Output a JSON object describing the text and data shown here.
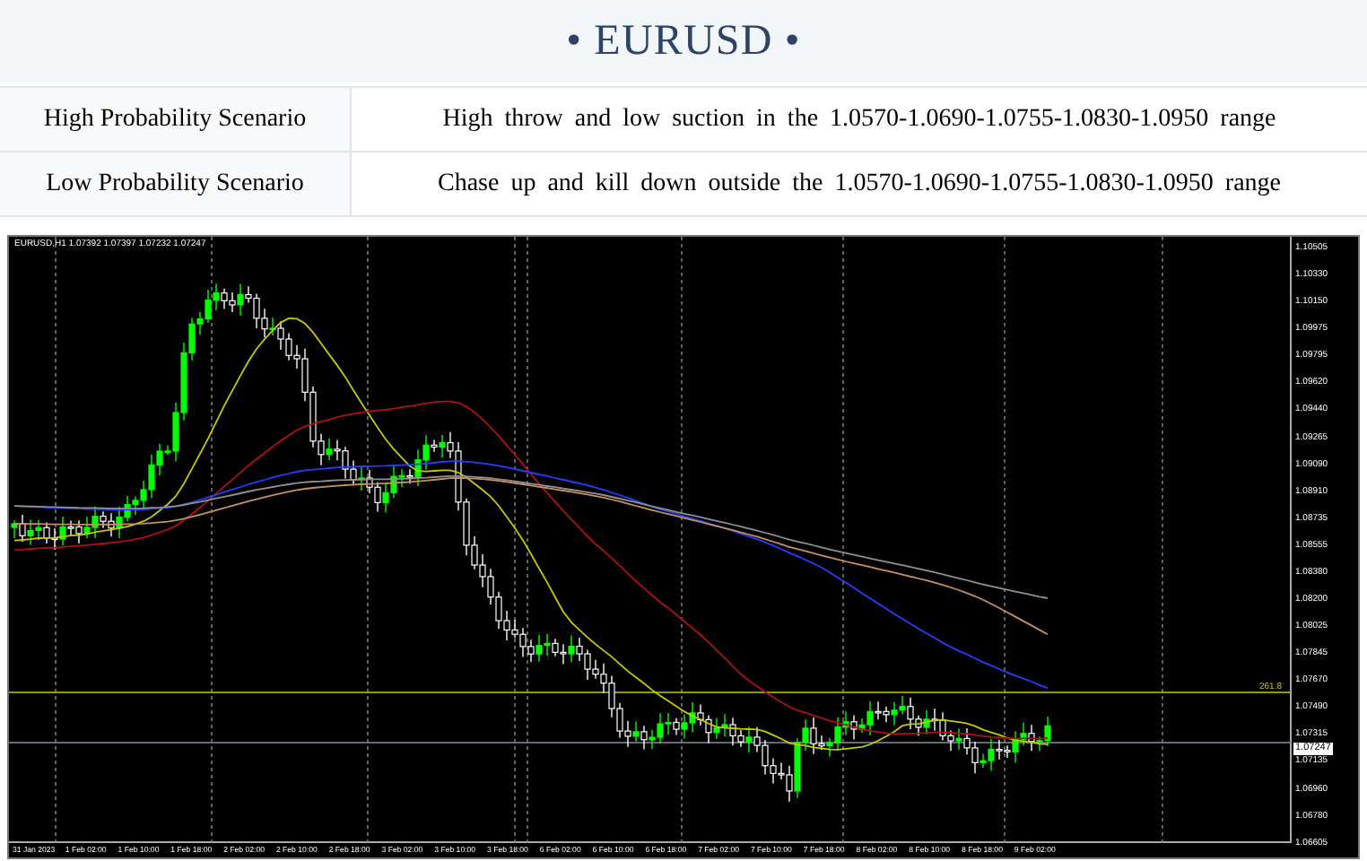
{
  "title": "• EURUSD •",
  "scenarios": [
    {
      "label": "High Probability Scenario",
      "description": "High throw and low suction in the 1.0570-1.0690-1.0755-1.0830-1.0950 range"
    },
    {
      "label": "Low Probability Scenario",
      "description": "Chase up and kill down outside the 1.0570-1.0690-1.0755-1.0830-1.0950 range"
    }
  ],
  "chart": {
    "header": "EURUSD,H1  1.07392 1.07397 1.07232 1.07247",
    "level_label": "261.8",
    "current_price": "1.07247",
    "price_labels": [
      "1.10505",
      "1.10330",
      "1.10150",
      "1.09975",
      "1.09795",
      "1.09620",
      "1.09440",
      "1.09265",
      "1.09090",
      "1.08910",
      "1.08735",
      "1.08555",
      "1.08380",
      "1.08200",
      "1.08025",
      "1.07845",
      "1.07670",
      "1.07490",
      "1.07315",
      "1.07135",
      "1.06960",
      "1.06780",
      "1.06605"
    ],
    "time_labels": [
      "31 Jan 2023",
      "1 Feb 02:00",
      "1 Feb 10:00",
      "1 Feb 18:00",
      "2 Feb 02:00",
      "2 Feb 10:00",
      "2 Feb 18:00",
      "3 Feb 02:00",
      "3 Feb 10:00",
      "3 Feb 18:00",
      "6 Feb 02:00",
      "6 Feb 10:00",
      "6 Feb 18:00",
      "7 Feb 02:00",
      "7 Feb 10:00",
      "7 Feb 18:00",
      "8 Feb 02:00",
      "8 Feb 10:00",
      "8 Feb 18:00",
      "9 Feb 02:00"
    ]
  }
}
